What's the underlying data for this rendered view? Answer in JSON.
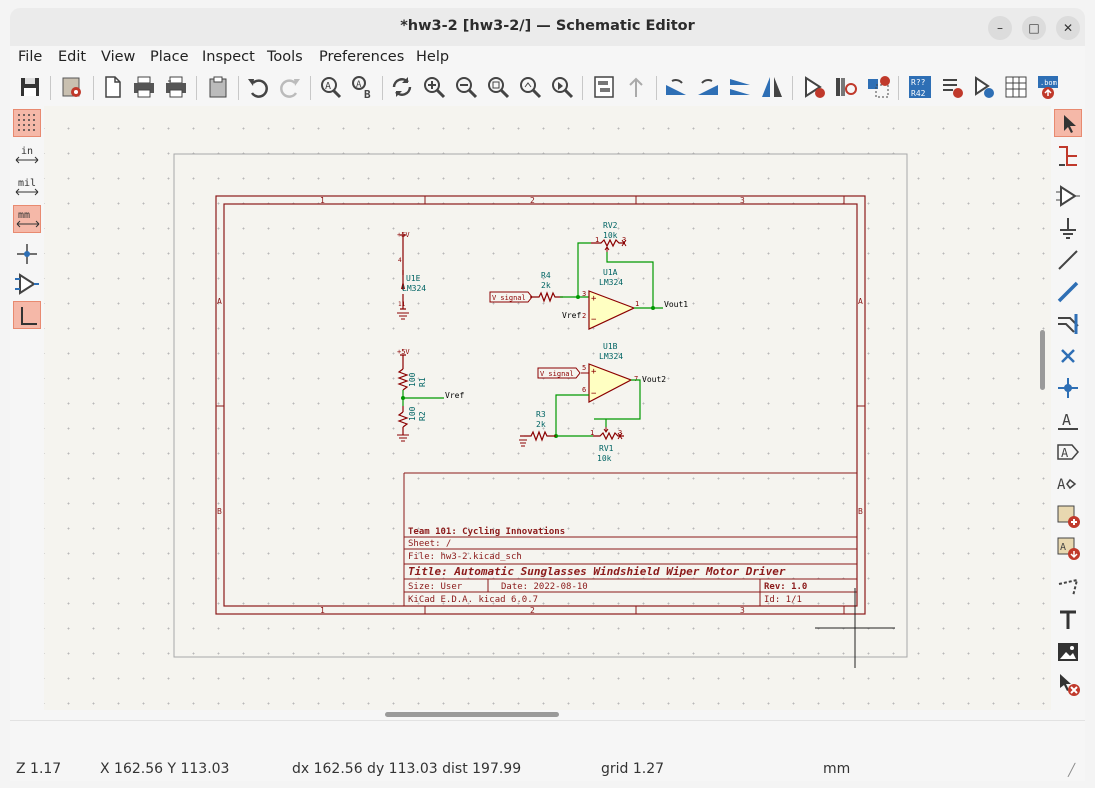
{
  "window": {
    "title": "*hw3-2 [hw3-2/] — Schematic Editor"
  },
  "menu": [
    "File",
    "Edit",
    "View",
    "Place",
    "Inspect",
    "Tools",
    "Preferences",
    "Help"
  ],
  "schematic": {
    "frame": {
      "col_labels": [
        "1",
        "2",
        "3"
      ],
      "row_labels": [
        "A",
        "B"
      ]
    },
    "power1": "+5V",
    "power2": "+5V",
    "u1e_ref": "U1E",
    "u1e_val": "LM324",
    "u1e_pin4": "4",
    "u1e_pin11": "11",
    "r1_ref": "R1",
    "r1_val": "100",
    "r2_ref": "R2",
    "r2_val": "100",
    "vref_label": "Vref",
    "rv2_ref": "RV2",
    "rv2_val": "10k",
    "r4_ref": "R4",
    "r4_val": "2k",
    "u1a_ref": "U1A",
    "u1a_val": "LM324",
    "vsignal_label_1": "V_signal",
    "vsignal_label_2": "V_signal",
    "vref_pin_label": "Vref",
    "vout1": "Vout1",
    "u1b_ref": "U1B",
    "u1b_val": "LM324",
    "vout2": "Vout2",
    "r3_ref": "R3",
    "r3_val": "2k",
    "rv1_ref": "RV1",
    "rv1_val": "10k",
    "pin_1": "1",
    "pin_2": "2",
    "pin_3": "3",
    "pin_5": "5",
    "pin_6": "6",
    "pin_7": "7",
    "plus": "+",
    "minus": "−",
    "title_block": {
      "company": "Team 101: Cycling Innovations",
      "sheet": "Sheet: /",
      "file": "File: hw3-2.kicad_sch",
      "title": "Title: Automatic Sunglasses Windshield Wiper Motor Driver",
      "size": "Size: User",
      "date": "Date: 2022-08-10",
      "rev": "Rev: 1.0",
      "tool": "KiCad E.D.A.  kicad 6.0.7",
      "id": "Id: 1/1"
    }
  },
  "status": {
    "zoom": "Z 1.17",
    "xy": "X 162.56  Y 113.03",
    "dxdy": "dx 162.56  dy 113.03  dist 197.99",
    "grid": "grid 1.27",
    "units": "mm"
  },
  "colors": {
    "sheet_border": "#8b1a1a",
    "wire": "#009900",
    "component": "#8b0000",
    "opamp_fill": "#ffffc2",
    "ref_text": "#006464",
    "active_tool": "#f5b8a8"
  },
  "icons": {
    "top_toolbar": [
      "save-icon",
      "schematic-setup-icon",
      "page-settings-icon",
      "print-icon",
      "plot-icon",
      "paste-icon",
      "undo-icon",
      "redo-icon",
      "find-icon",
      "find-replace-icon",
      "refresh-icon",
      "zoom-in-icon",
      "zoom-out-icon",
      "zoom-fit-icon",
      "zoom-objects-icon",
      "zoom-tool-icon",
      "hierarchy-navigator-icon",
      "leave-sheet-icon",
      "rotate-ccw-icon",
      "rotate-cw-icon",
      "mirror-vertical-icon",
      "mirror-horizontal-icon",
      "symbol-editor-icon",
      "symbol-library-browser-icon",
      "footprint-assign-icon",
      "annotate-icon",
      "erc-icon",
      "symbol-fields-table-icon",
      "footprint-editor-icon",
      "bom-icon"
    ],
    "left_toolbar": [
      "grid-icon",
      "inches-icon",
      "mils-icon",
      "millimeters-icon",
      "cursor-crosshair-icon",
      "hidden-pins-icon",
      "line-mode-icon"
    ],
    "right_toolbar": [
      "select-icon",
      "highlight-net-icon",
      "add-symbol-icon",
      "add-power-icon",
      "add-wire-icon",
      "add-bus-icon",
      "add-bus-entry-icon",
      "no-connect-icon",
      "add-junction-icon",
      "add-label-icon",
      "add-global-label-icon",
      "add-hier-label-icon",
      "add-sheet-icon",
      "import-sheet-pin-icon",
      "add-graphic-line-icon",
      "add-text-icon",
      "add-image-icon",
      "delete-icon"
    ]
  }
}
